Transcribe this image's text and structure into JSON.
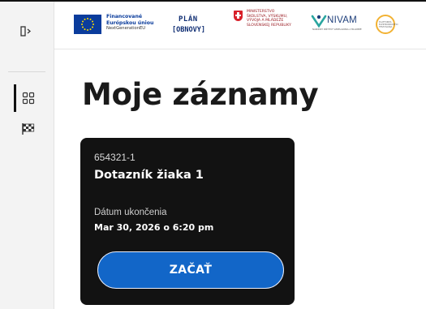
{
  "sidebar": {
    "toggle_icon": "sidebar-expand-icon",
    "items": [
      {
        "icon": "dashboard-grid-icon",
        "active": true
      },
      {
        "icon": "checkered-flag-icon",
        "active": false
      }
    ]
  },
  "header": {
    "logos": {
      "eu": {
        "line1": "Financované",
        "line2": "Európskou úniou",
        "line3": "NextGenerationEU"
      },
      "plan": {
        "line1": "PLÁN",
        "line2": "[OBNOVY]"
      },
      "ministry": {
        "line1": "MINISTERSTVO",
        "line2": "ŠKOLSTVA, VÝSKUMU,",
        "line3": "VÝVOJA A MLÁDEŽE",
        "line4": "SLOVENSKEJ REPUBLIKY"
      },
      "nivam": {
        "name": "NIVAM",
        "subtitle": "NÁRODNÝ INŠTITÚT VZDELÁVANIA A MLÁDEŽE"
      },
      "platforma": {
        "line1": "PLATFORMA",
        "line2": "ELEKTRONICKÉHO",
        "line3": "TESTOVANIA"
      }
    }
  },
  "main": {
    "title": "Moje záznamy",
    "cards": [
      {
        "id": "654321-1",
        "title": "Dotazník žiaka 1",
        "date_label": "Dátum ukončenia",
        "date_value": "Mar 30, 2026 o 6:20 pm",
        "button_label": "ZAČAŤ"
      }
    ]
  },
  "colors": {
    "card_background": "#121212",
    "button_blue": "#1266c8",
    "sidebar_background": "#f3f3f3",
    "eu_blue": "#0a3c9c",
    "ministry_red": "#d8202a",
    "nivam_navy": "#1d3e7a",
    "platforma_yellow": "#f2b233"
  }
}
